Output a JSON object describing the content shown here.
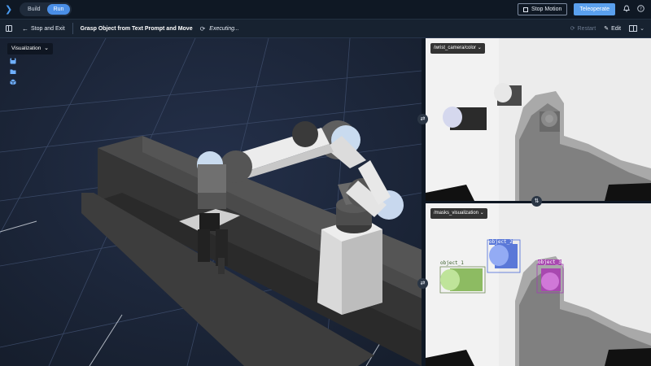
{
  "topbar": {
    "modes": [
      "Build",
      "Run"
    ],
    "active_mode": "Run",
    "stop_motion_label": "Stop Motion",
    "teleoperate_label": "Teleoperate"
  },
  "toolbar": {
    "stop_and_exit_label": "Stop and Exit",
    "task_title": "Grasp Object from Text Prompt and Move",
    "status": "Executing...",
    "restart_label": "Restart",
    "edit_label": "Edit"
  },
  "viewport": {
    "visualization_label": "Visualization"
  },
  "cameras": {
    "top_topic": "/wrist_camera/color",
    "bottom_topic": "/masks_visualization"
  },
  "masks": {
    "labels": [
      "object_1",
      "object_2",
      "object_3"
    ]
  },
  "colors": {
    "accent": "#4a8ee6",
    "mask_green": "#a8d67a",
    "mask_blue": "#6f8ff0",
    "mask_purple": "#c060c8"
  }
}
